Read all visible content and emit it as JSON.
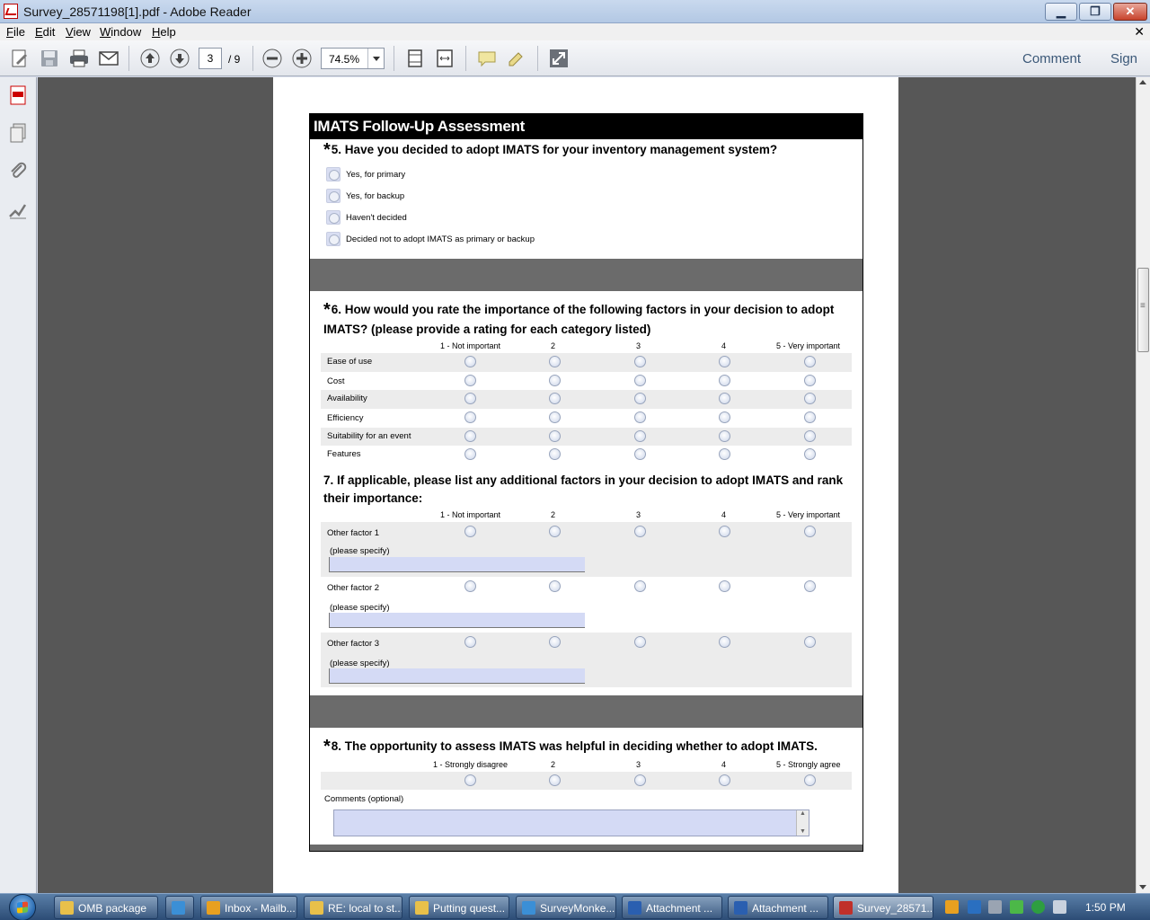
{
  "window": {
    "title": "Survey_28571198[1].pdf - Adobe Reader",
    "min_glyph": "▁",
    "max_glyph": "❐",
    "close_glyph": "✕"
  },
  "menu": {
    "items": [
      "File",
      "Edit",
      "View",
      "Window",
      "Help"
    ],
    "close_glyph": "✕"
  },
  "toolbar": {
    "page_current": "3",
    "page_total": "/ 9",
    "zoom": "74.5%",
    "comment_label": "Comment",
    "sign_label": "Sign"
  },
  "survey": {
    "header": "IMATS Follow-Up Assessment",
    "q5": {
      "star": "*",
      "text": "5. Have you decided to adopt IMATS for your inventory management system?",
      "options": [
        "Yes, for primary",
        "Yes, for backup",
        "Haven't decided",
        "Decided not to adopt IMATS as primary or backup"
      ]
    },
    "q6": {
      "star": "*",
      "text_line1": "6. How would you rate the importance of the following factors in your decision to adopt",
      "text_line2": "IMATS? (please provide a rating for each category listed)",
      "columns": [
        "1 - Not important",
        "2",
        "3",
        "4",
        "5 - Very important"
      ],
      "rows": [
        "Ease of use",
        "Cost",
        "Availability",
        "Efficiency",
        "Suitability for an event",
        "Features"
      ]
    },
    "q7": {
      "text_line1": "7. If applicable, please list any additional factors in your decision to adopt IMATS and rank",
      "text_line2": "their importance:",
      "columns": [
        "1 - Not important",
        "2",
        "3",
        "4",
        "5 - Very important"
      ],
      "rows": [
        "Other factor 1",
        "Other factor 2",
        "Other factor 3"
      ],
      "specify_label": "(please specify)"
    },
    "q8": {
      "star": "*",
      "text": "8. The opportunity to assess IMATS was helpful in deciding whether to adopt IMATS.",
      "columns": [
        "1 - Strongly disagree",
        "2",
        "3",
        "4",
        "5 - Strongly agree"
      ],
      "comments_label": "Comments (optional)"
    }
  },
  "taskbar": {
    "items": [
      {
        "label": "OMB package",
        "color": "#e8c04a"
      },
      {
        "label": "",
        "color": "#3b8fd6"
      },
      {
        "label": "Inbox - Mailb...",
        "color": "#e8a020"
      },
      {
        "label": "RE: local to st...",
        "color": "#e8c04a"
      },
      {
        "label": "Putting quest...",
        "color": "#e8c04a"
      },
      {
        "label": "SurveyMonke...",
        "color": "#3b8fd6"
      },
      {
        "label": "Attachment ...",
        "color": "#2a5fb0"
      },
      {
        "label": "Attachment ...",
        "color": "#2a5fb0"
      },
      {
        "label": "Survey_28571...",
        "color": "#c0302a"
      }
    ],
    "clock": "1:50 PM"
  }
}
